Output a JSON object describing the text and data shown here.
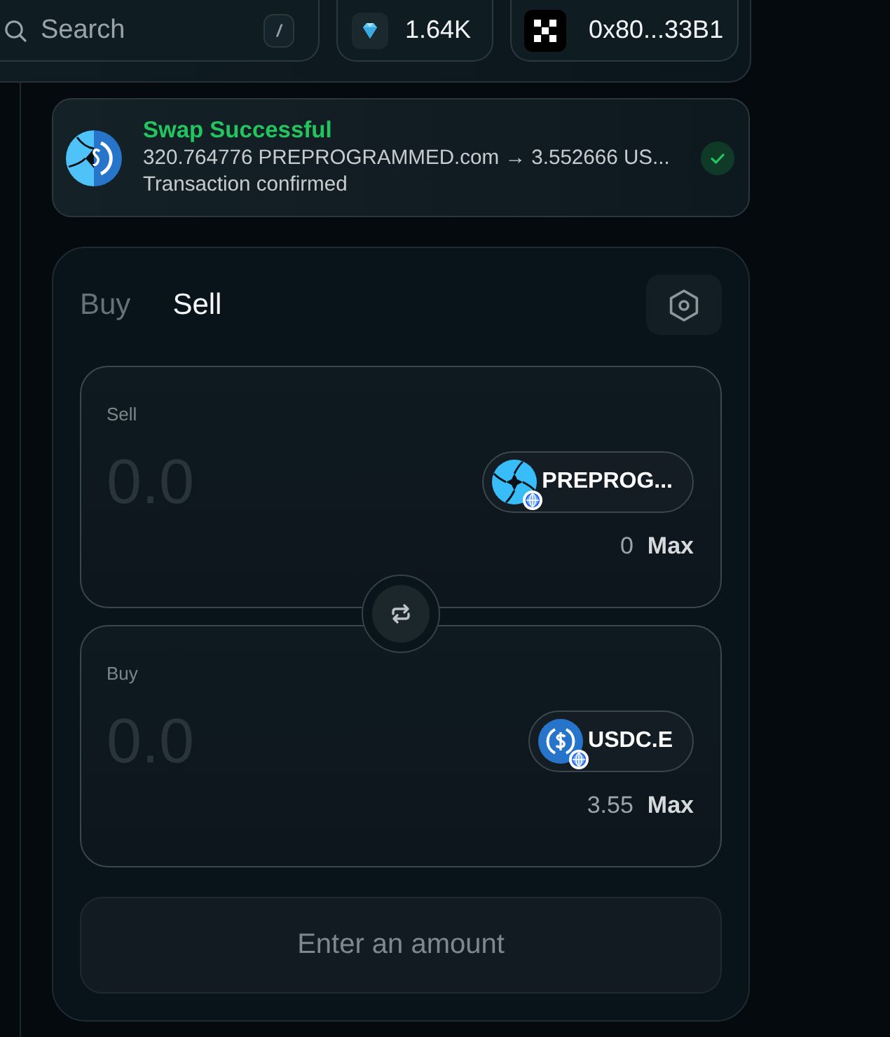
{
  "header": {
    "search": {
      "placeholder": "Search",
      "shortcut": "/"
    },
    "points": {
      "value": "1.64K"
    },
    "wallet": {
      "address": "0x80...33B1"
    }
  },
  "toast": {
    "title": "Swap Successful",
    "detail": "320.764776 PREPROGRAMMED.com → 3.552666 US...",
    "status": "Transaction confirmed",
    "confirmed": true
  },
  "swap": {
    "tabs": [
      {
        "label": "Buy",
        "selected": false
      },
      {
        "label": "Sell",
        "selected": true
      }
    ],
    "panels": [
      {
        "label": "Sell",
        "placeholder": "0.0",
        "token": "PREPROG...",
        "balance": "0",
        "max_label": "Max"
      },
      {
        "label": "Buy",
        "placeholder": "0.0",
        "token": "USDC.E",
        "balance": "3.55",
        "max_label": "Max"
      }
    ],
    "submit": {
      "label": "Enter an amount",
      "disabled": true
    }
  }
}
